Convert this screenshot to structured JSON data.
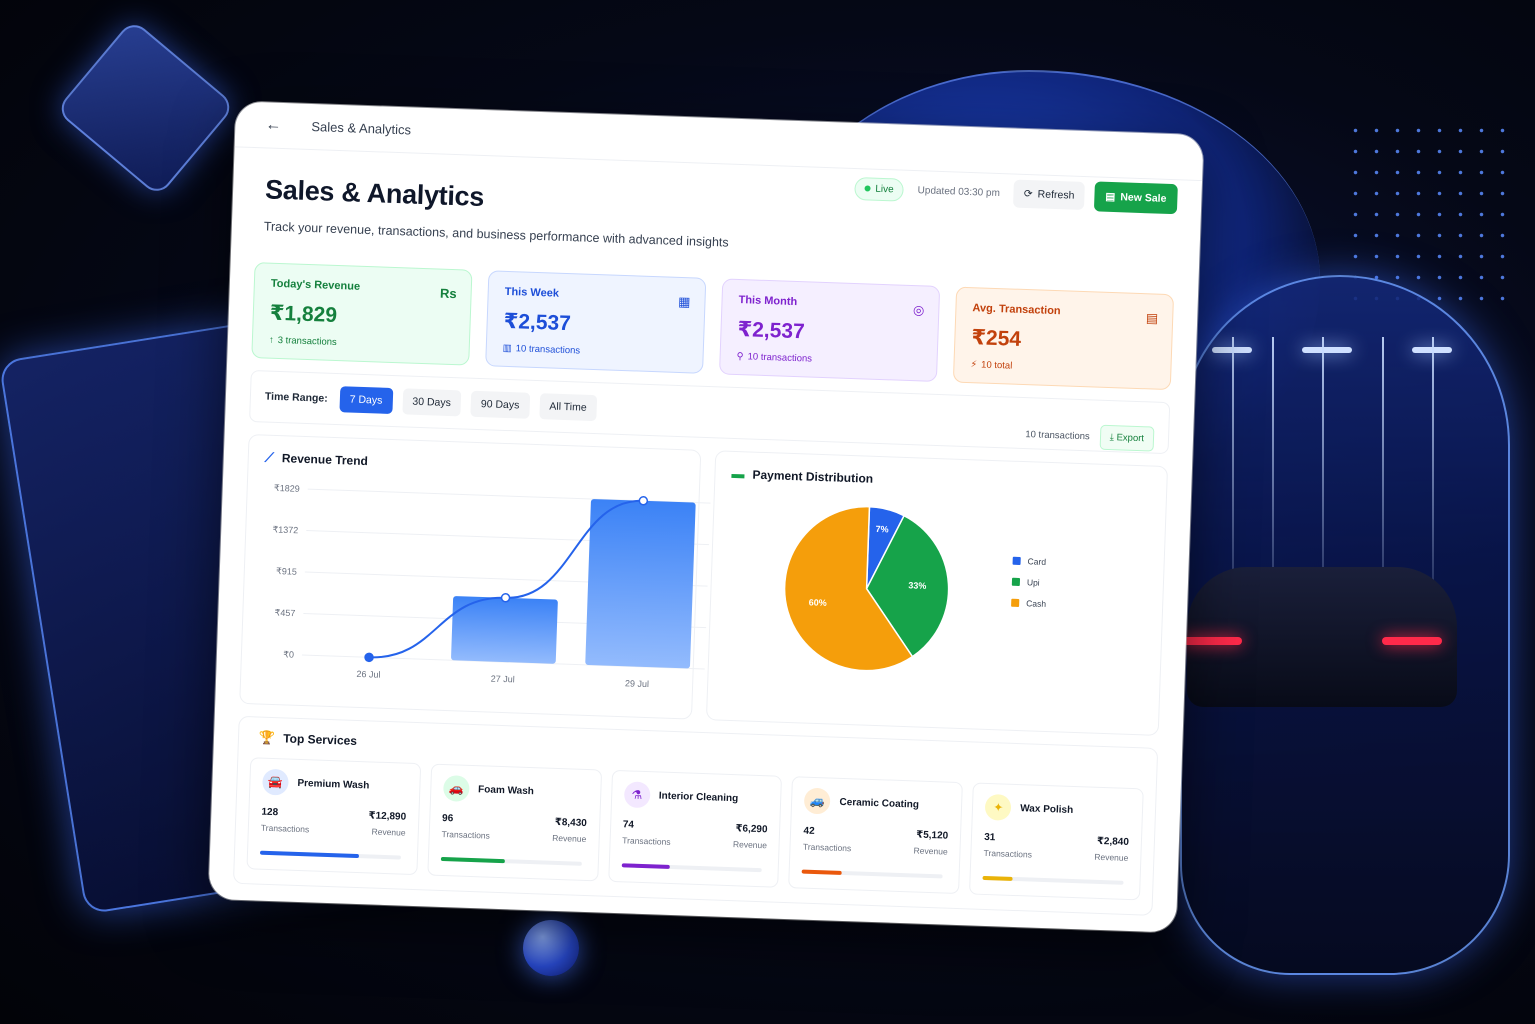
{
  "topbar": {
    "breadcrumb": "Sales & Analytics"
  },
  "header": {
    "title": "Sales & Analytics",
    "subtitle": "Track your revenue, transactions, and business performance with advanced insights",
    "live_label": "Live",
    "updated_label": "Updated 03:30 pm",
    "refresh_label": "Refresh",
    "new_sale_label": "New Sale"
  },
  "stats": [
    {
      "label": "Today's Revenue",
      "value": "₹1,829",
      "sub": "3 transactions",
      "icon": "rupee-icon",
      "icon_glyph": "Rs",
      "sub_glyph": "↑",
      "color": "#15803d"
    },
    {
      "label": "This Week",
      "value": "₹2,537",
      "sub": "10 transactions",
      "icon": "calendar-icon",
      "icon_glyph": "▦",
      "sub_glyph": "▥",
      "color": "#1d4ed8"
    },
    {
      "label": "This Month",
      "value": "₹2,537",
      "sub": "10 transactions",
      "icon": "target-icon",
      "icon_glyph": "◎",
      "sub_glyph": "⚲",
      "color": "#7e22ce"
    },
    {
      "label": "Avg. Transaction",
      "value": "₹254",
      "sub": "10 total",
      "icon": "receipt-icon",
      "icon_glyph": "▤",
      "sub_glyph": "⚡",
      "color": "#c2410c"
    }
  ],
  "filter": {
    "label": "Time Range:",
    "options": [
      "7 Days",
      "30 Days",
      "90 Days",
      "All Time"
    ],
    "active": "7 Days",
    "count": "10 transactions",
    "export_label": "Export"
  },
  "revenue_panel": {
    "title": "Revenue Trend"
  },
  "payment_panel": {
    "title": "Payment Distribution"
  },
  "chart_data": [
    {
      "type": "bar",
      "title": "Revenue Trend",
      "categories": [
        "26 Jul",
        "27 Jul",
        "29 Jul"
      ],
      "values": [
        0,
        708,
        1829
      ],
      "y_tick_labels": [
        "₹0",
        "₹457",
        "₹915",
        "₹1372",
        "₹1829"
      ],
      "ylim": [
        0,
        1829
      ],
      "grid": true,
      "overlay_line": true,
      "bar_color": "#3b82f6",
      "line_color": "#2563eb"
    },
    {
      "type": "pie",
      "title": "Payment Distribution",
      "slices": [
        {
          "name": "Card",
          "value": 7,
          "label": "7%",
          "color": "#2563eb"
        },
        {
          "name": "Upi",
          "value": 33,
          "label": "33%",
          "color": "#16a34a"
        },
        {
          "name": "Cash",
          "value": 60,
          "label": "60%",
          "color": "#f59e0b"
        }
      ],
      "legend_position": "right"
    }
  ],
  "services": {
    "title": "Top Services",
    "items": [
      {
        "name": "Premium Wash",
        "transactions": "128",
        "transactions_label": "Transactions",
        "revenue": "₹12,890",
        "revenue_label": "Revenue",
        "icon": "car-wash-icon",
        "glyph": "🚘",
        "color": "#2563eb",
        "bg": "#e0eaff",
        "share": 1.0
      },
      {
        "name": "Foam Wash",
        "transactions": "96",
        "transactions_label": "Transactions",
        "revenue": "₹8,430",
        "revenue_label": "Revenue",
        "icon": "car-icon",
        "glyph": "🚗",
        "color": "#16a34a",
        "bg": "#dcfce7",
        "share": 0.65
      },
      {
        "name": "Interior Cleaning",
        "transactions": "74",
        "transactions_label": "Transactions",
        "revenue": "₹6,290",
        "revenue_label": "Revenue",
        "icon": "flask-icon",
        "glyph": "⚗",
        "color": "#7e22ce",
        "bg": "#f3e8ff",
        "share": 0.49
      },
      {
        "name": "Ceramic Coating",
        "transactions": "42",
        "transactions_label": "Transactions",
        "revenue": "₹5,120",
        "revenue_label": "Revenue",
        "icon": "shield-car-icon",
        "glyph": "🚙",
        "color": "#ea580c",
        "bg": "#ffedd5",
        "share": 0.4
      },
      {
        "name": "Wax Polish",
        "transactions": "31",
        "transactions_label": "Transactions",
        "revenue": "₹2,840",
        "revenue_label": "Revenue",
        "icon": "spray-icon",
        "glyph": "✦",
        "color": "#eab308",
        "bg": "#fef9c3",
        "share": 0.3
      }
    ]
  }
}
